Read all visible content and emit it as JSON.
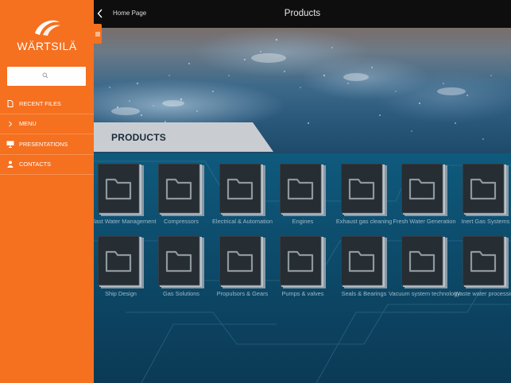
{
  "sidebar": {
    "logo_text": "WÄRTSILÄ",
    "search_icon": "search-icon",
    "items": [
      {
        "label": "RECENT FILES",
        "icon": "file-icon"
      },
      {
        "label": "MENU",
        "icon": "chevron-right-icon"
      },
      {
        "label": "PRESENTATIONS",
        "icon": "presentation-icon"
      },
      {
        "label": "CONTACTS",
        "icon": "person-icon"
      }
    ],
    "color": "#f5701f"
  },
  "topbar": {
    "back_label": "Home Page",
    "title": "Products"
  },
  "section": {
    "title": "PRODUCTS"
  },
  "folders": [
    {
      "label": "Ballast Water Management"
    },
    {
      "label": "Compressors"
    },
    {
      "label": "Electrical & Automation"
    },
    {
      "label": "Engines"
    },
    {
      "label": "Exhaust gas cleaning"
    },
    {
      "label": "Fresh Water Generation"
    },
    {
      "label": "Inert Gas Systems"
    },
    {
      "label": "Ship Design"
    },
    {
      "label": "Gas Solutions"
    },
    {
      "label": "Propulsors & Gears"
    },
    {
      "label": "Pumps & valves"
    },
    {
      "label": "Seals & Bearings"
    },
    {
      "label": "Vacuum system technology"
    },
    {
      "label": "Waste water processing"
    }
  ]
}
